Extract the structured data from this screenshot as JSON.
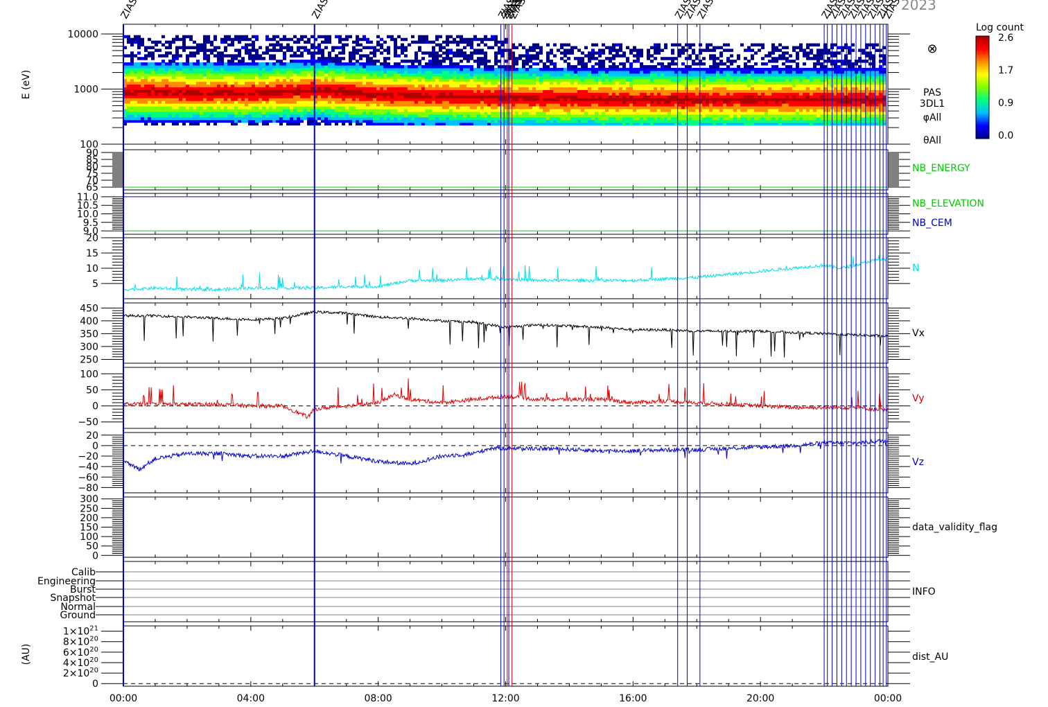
{
  "header": {
    "year_fragment": "2023"
  },
  "colorbar": {
    "title": "Log count",
    "ticks": [
      "2.6",
      "1.7",
      "0.9",
      "0.0"
    ],
    "colors": [
      "#00008b",
      "#0000ff",
      "#00bfff",
      "#00ff7f",
      "#7fff00",
      "#ffff00",
      "#ff8c00",
      "#ff0000",
      "#b00000"
    ]
  },
  "time_axis": {
    "tick_labels": [
      "00:00",
      "04:00",
      "08:00",
      "12:00",
      "16:00",
      "20:00",
      "00:00"
    ],
    "range_hours": [
      0,
      24
    ]
  },
  "event_markers": {
    "label": "ZIAS",
    "color": "#0000cc",
    "red_color": "#cc0000",
    "times_hours": [
      0.0,
      6.0,
      11.85,
      11.95,
      12.1,
      17.4,
      17.7,
      18.1,
      22.0,
      22.1,
      22.25,
      22.4,
      22.55,
      22.7,
      22.85,
      23.0,
      23.15,
      23.3,
      23.45,
      23.6,
      23.75,
      23.85,
      23.95
    ],
    "red_times_hours": [
      12.05,
      12.2
    ]
  },
  "panels": {
    "spectrogram": {
      "ylabel": "E (eV)",
      "tick_labels": [
        "10000",
        "1000",
        "100"
      ],
      "side_labels": [
        "PAS",
        "3DL1",
        "φAll",
        "θAll"
      ],
      "symbol": "⊗"
    },
    "nb_energy": {
      "tick_labels": [
        "90",
        "85",
        "80",
        "75",
        "70",
        "65"
      ],
      "label": "NB_ENERGY",
      "color": "#00cc00"
    },
    "nb_elev": {
      "tick_labels": [
        "11.0",
        "10.5",
        "10.0",
        "9.5",
        "9.0"
      ],
      "labels": [
        {
          "text": "NB_ELEVATION",
          "color": "#00cc00"
        },
        {
          "text": "NB_CEM",
          "color": "#0000cc"
        }
      ]
    },
    "n": {
      "tick_labels": [
        "20",
        "15",
        "10",
        "5"
      ],
      "label": "N",
      "color": "#00e0e8"
    },
    "vx": {
      "tick_labels": [
        "450",
        "400",
        "350",
        "300",
        "250"
      ],
      "label": "Vx",
      "color": "#000000"
    },
    "vy": {
      "tick_labels": [
        "100",
        "50",
        "0",
        "−50"
      ],
      "label": "Vy",
      "color": "#dd0000"
    },
    "vz": {
      "tick_labels": [
        "20",
        "0",
        "−20",
        "−40",
        "−60",
        "−80"
      ],
      "label": "Vz",
      "color": "#0000cc"
    },
    "validity": {
      "tick_labels": [
        "300",
        "250",
        "200",
        "150",
        "100",
        "50",
        "0"
      ],
      "label": "data_validity_flag"
    },
    "info": {
      "tick_labels": [
        "Calib",
        "Engineering",
        "Burst",
        "Snapshot",
        "Normal",
        "Ground"
      ],
      "label": "INFO"
    },
    "dist": {
      "ylabel": "(AU)",
      "tick_mantissas": [
        "1",
        "8",
        "6",
        "4",
        "2",
        "0"
      ],
      "tick_exponents": [
        "21",
        "20",
        "20",
        "20",
        "20",
        ""
      ],
      "label": "dist_AU"
    }
  },
  "chart_data": [
    {
      "type": "heatmap",
      "title": "",
      "ylabel": "E (eV)",
      "y_scale": "log",
      "ylim": [
        100,
        15000
      ],
      "x_range_hours": [
        0,
        24
      ],
      "z_label": "Log count",
      "z_range": [
        0.0,
        2.6
      ],
      "peak_energy_eV": [
        {
          "t": 0,
          "E": 900
        },
        {
          "t": 4,
          "E": 850
        },
        {
          "t": 6,
          "E": 950
        },
        {
          "t": 8,
          "E": 800
        },
        {
          "t": 10,
          "E": 750
        },
        {
          "t": 12,
          "E": 700
        },
        {
          "t": 16,
          "E": 650
        },
        {
          "t": 20,
          "E": 650
        },
        {
          "t": 24,
          "E": 650
        }
      ]
    },
    {
      "type": "line",
      "ylabel": "NB_ENERGY",
      "ylim": [
        63,
        92
      ],
      "series": [
        {
          "name": "NB_ENERGY",
          "x": [
            0,
            24
          ],
          "values": [
            65,
            65
          ]
        }
      ]
    },
    {
      "type": "line",
      "ylabel": "NB_ELEVATION / NB_CEM",
      "ylim": [
        8.8,
        11.2
      ],
      "series": [
        {
          "name": "NB_ELEVATION",
          "x": [
            0,
            24
          ],
          "values": [
            9.0,
            9.0
          ]
        },
        {
          "name": "NB_CEM",
          "x": [
            0,
            24
          ],
          "values": [
            11.0,
            11.0
          ]
        }
      ]
    },
    {
      "type": "line",
      "ylim": [
        0,
        20
      ],
      "series": [
        {
          "name": "N",
          "x": [
            0,
            1,
            2,
            3,
            4,
            5,
            6,
            7,
            8,
            9,
            10,
            11,
            12,
            13,
            14,
            15,
            16,
            17,
            18,
            19,
            20,
            21,
            22,
            22.5,
            23,
            23.5,
            24
          ],
          "values": [
            3,
            3.5,
            3,
            3,
            3.5,
            3.5,
            3.5,
            4,
            4,
            6,
            6,
            6.5,
            6.5,
            6,
            6,
            6,
            6,
            6.5,
            7,
            8,
            9,
            10,
            11,
            10,
            11,
            12.5,
            13
          ]
        }
      ]
    },
    {
      "type": "line",
      "ylim": [
        235,
        470
      ],
      "series": [
        {
          "name": "Vx",
          "x": [
            0,
            1,
            2,
            3,
            4,
            5,
            6,
            7,
            8,
            9,
            10,
            11,
            12,
            13,
            14,
            15,
            16,
            17,
            18,
            19,
            20,
            21,
            22,
            23,
            24
          ],
          "values": [
            420,
            420,
            415,
            410,
            405,
            410,
            435,
            430,
            415,
            410,
            400,
            395,
            375,
            385,
            380,
            375,
            365,
            365,
            360,
            360,
            360,
            355,
            350,
            345,
            340
          ]
        }
      ]
    },
    {
      "type": "line",
      "ylim": [
        -70,
        120
      ],
      "series": [
        {
          "name": "Vy",
          "x": [
            0,
            1,
            2,
            3,
            4,
            5,
            5.8,
            6,
            7,
            8,
            8.5,
            9,
            10,
            11,
            12,
            13,
            14,
            15,
            16,
            17,
            18,
            19,
            20,
            21,
            22,
            23,
            24
          ],
          "values": [
            5,
            5,
            5,
            5,
            0,
            0,
            -35,
            -10,
            0,
            10,
            35,
            20,
            10,
            20,
            30,
            20,
            20,
            20,
            10,
            15,
            10,
            5,
            0,
            -5,
            -5,
            -5,
            -15
          ]
        }
      ]
    },
    {
      "type": "line",
      "ylim": [
        -90,
        25
      ],
      "series": [
        {
          "name": "Vz",
          "x": [
            0,
            0.5,
            1,
            2,
            3,
            4,
            5,
            6,
            7,
            8,
            9,
            10,
            11,
            11.5,
            12,
            13,
            14,
            15,
            16,
            17,
            18,
            19,
            20,
            21,
            22,
            23,
            24
          ],
          "values": [
            -30,
            -45,
            -25,
            -15,
            -15,
            -20,
            -20,
            -10,
            -20,
            -30,
            -35,
            -20,
            -15,
            -5,
            -5,
            -5,
            -7,
            -10,
            -10,
            -8,
            -8,
            -5,
            -3,
            0,
            5,
            5,
            10
          ]
        }
      ]
    },
    {
      "type": "line",
      "ylabel": "data_validity_flag",
      "ylim": [
        -10,
        310
      ],
      "series": [
        {
          "name": "data_validity_flag",
          "x": [],
          "values": []
        }
      ]
    },
    {
      "type": "line",
      "ylabel": "INFO",
      "categories": [
        "Calib",
        "Engineering",
        "Burst",
        "Snapshot",
        "Normal",
        "Ground"
      ],
      "series": []
    },
    {
      "type": "line",
      "ylabel": "(AU)",
      "ylim": [
        -5e+19,
        1.1e+21
      ],
      "series": [
        {
          "name": "dist_AU",
          "x": [
            0,
            24
          ],
          "values": [
            0,
            0
          ]
        }
      ]
    }
  ]
}
